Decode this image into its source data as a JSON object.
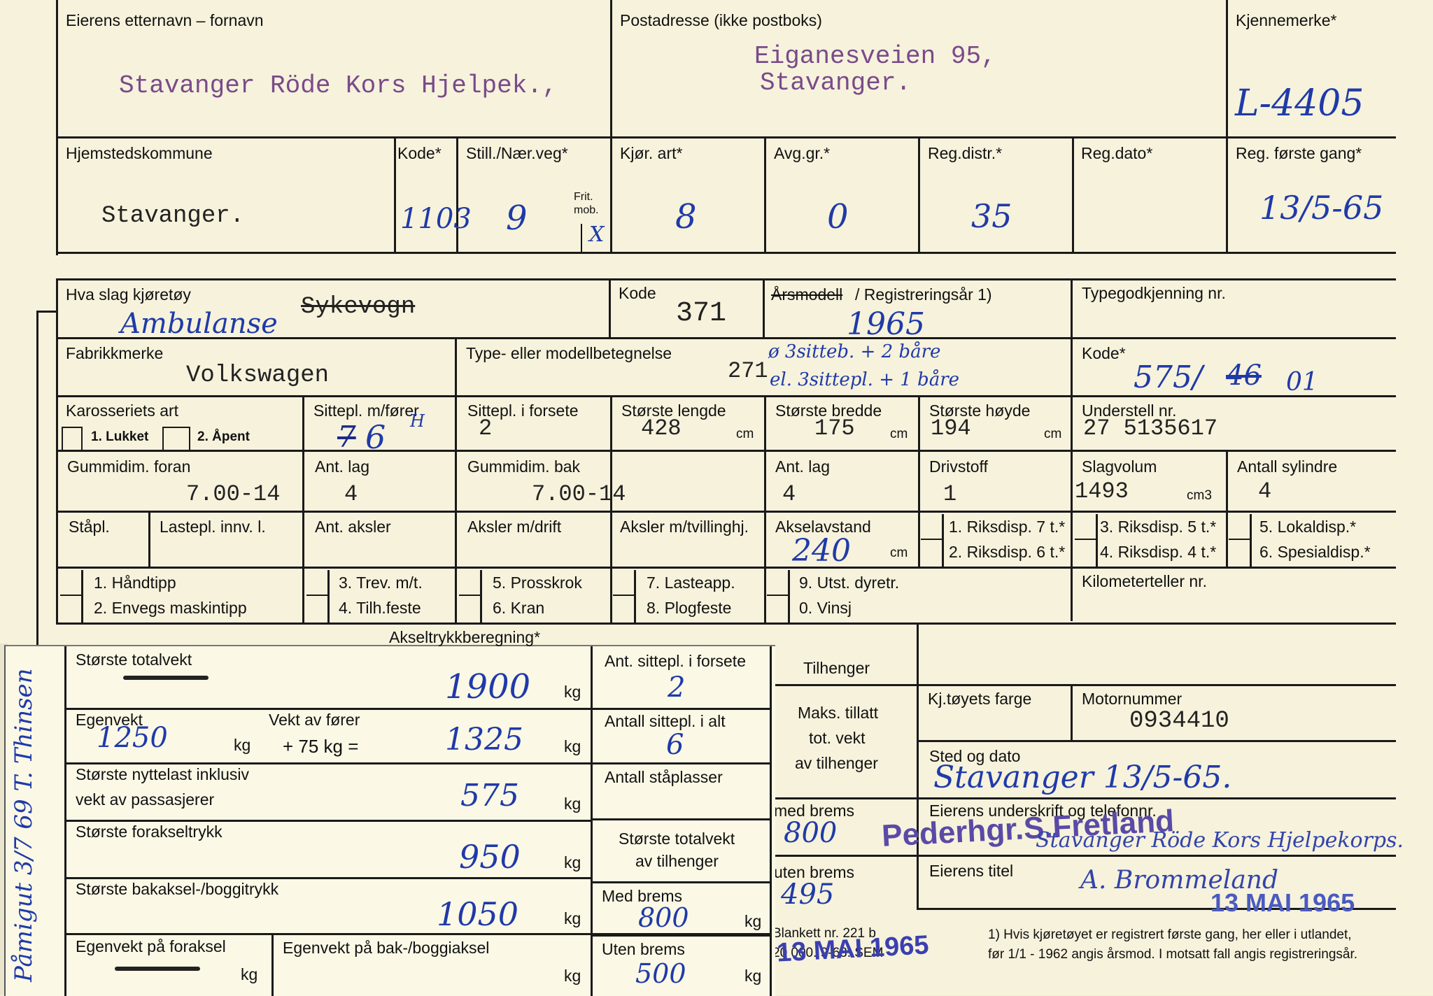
{
  "top": {
    "owner_label": "Eierens etternavn – fornavn",
    "owner_value": "Stavanger Röde Kors Hjelpek.,",
    "address_label": "Postadresse (ikke postboks)",
    "address_line1": "Eiganesveien 95,",
    "address_line2": "Stavanger.",
    "plate_label": "Kjennemerke*",
    "plate_value": "L-4405"
  },
  "row2": {
    "home_label": "Hjemstedskommune",
    "home_value": "Stavanger.",
    "kode_label": "Kode*",
    "kode_value": "1103",
    "still_label": "Still./Nær.veg*",
    "still_value": "9",
    "frit_label": "Frit. mob.",
    "frit_mark": "X",
    "kjor_label": "Kjør. art*",
    "kjor_value": "8",
    "avg_label": "Avg.gr.*",
    "avg_value": "0",
    "regdistr_label": "Reg.distr.*",
    "regdistr_value": "35",
    "regdato_label": "Reg.dato*",
    "regforste_label": "Reg. første gang*",
    "regforste_value": "13/5-65"
  },
  "vehicle": {
    "slag_label": "Hva slag kjøretøy",
    "slag_struck": "Sykevogn",
    "slag_hand": "Ambulanse",
    "kode_label": "Kode",
    "kode_value": "371",
    "aarsmodell_struck": "Årsmodell",
    "regaar_label": "/ Registreringsår 1)",
    "regaar_value": "1965",
    "typegodkj_label": "Typegodkjenning nr.",
    "fabrikk_label": "Fabrikkmerke",
    "fabrikk_value": "Volkswagen",
    "type_label": "Type- eller modellbetegnelse",
    "type_value": "271",
    "type_hand1": "ø 3sitteb. + 2 båre",
    "type_hand2": "el. 3sittepl. + 1 båre",
    "kode2_label": "Kode*",
    "kode2_hand": "575/",
    "kode2_struck": "46",
    "kode2_suffix": "01",
    "karosseri_label": "Karosseriets art",
    "lukket_label": "1. Lukket",
    "apent_label": "2. Åpent",
    "sittepl_label": "Sittepl. m/fører",
    "sittepl_hand": "6",
    "sittepl_struck": "7",
    "sittepl_sup": "H",
    "sitteforsete_label": "Sittepl. i forsete",
    "sitteforsete_value": "2",
    "lengde_label": "Største lengde",
    "lengde_value": "428",
    "bredde_label": "Største bredde",
    "bredde_value": "175",
    "hoyde_label": "Største høyde",
    "hoyde_value": "194",
    "cm": "cm",
    "understell_label": "Understell nr.",
    "understell_value": "27 5135617",
    "gummi_foran_label": "Gummidim. foran",
    "gummi_foran_value": "7.00-14",
    "antlag_label": "Ant. lag",
    "antlag1_value": "4",
    "gummi_bak_label": "Gummidim. bak",
    "gummi_bak_value": "7.00-14",
    "antlag2_value": "4",
    "drivstoff_label": "Drivstoff",
    "drivstoff_value": "1",
    "slagvolum_label": "Slagvolum",
    "slagvolum_value": "1493",
    "cm3": "cm3",
    "sylindre_label": "Antall sylindre",
    "sylindre_value": "4",
    "stapl_label": "Ståpl.",
    "lastepl_label": "Lastepl. innv. l.",
    "antaksler_label": "Ant. aksler",
    "aksler_drift_label": "Aksler m/drift",
    "aksler_tvill_label": "Aksler m/tvillinghj.",
    "akselavstand_label": "Akselavstand",
    "akselavstand_value": "240",
    "riks1": "1. Riksdisp. 7 t.*",
    "riks2": "2. Riksdisp. 6 t.*",
    "riks3": "3. Riksdisp. 5 t.*",
    "riks4": "4. Riksdisp. 4 t.*",
    "lokal5": "5. Lokaldisp.*",
    "spes6": "6. Spesialdisp.*",
    "o1": "1. Håndtipp",
    "o2": "2. Envegs maskintipp",
    "o3": "3. Trev. m/t.",
    "o4": "4. Tilh.feste",
    "o5": "5. Prosskrok",
    "o6": "6. Kran",
    "o7": "7. Lasteapp.",
    "o8": "8. Plogfeste",
    "o9": "9. Utst. dyretr.",
    "o0": "0. Vinsj",
    "km_label": "Kilometerteller nr."
  },
  "lower": {
    "akseltrykk_label": "Akseltrykkberegning*",
    "totalvekt_label": "Største totalvekt",
    "totalvekt_value": "1900",
    "kg": "kg",
    "egenvekt_label": "Egenvekt",
    "egenvekt_value": "1250",
    "forer_label": "Vekt av fører",
    "forer_expr": "+ 75 kg =",
    "sum_value": "1325",
    "nyttelast_label1": "Største nyttelast inklusiv",
    "nyttelast_label2": "vekt av passasjerer",
    "nyttelast_value": "575",
    "foraksel_label": "Største forakseltrykk",
    "foraksel_value": "950",
    "bakaksel_label": "Største bakaksel-/boggitrykk",
    "bakaksel_value": "1050",
    "egen_foraksel_label": "Egenvekt på foraksel",
    "egen_bakaksel_label": "Egenvekt på bak-/boggiaksel",
    "sitteforsete_label": "Ant. sittepl. i forsete",
    "sitteforsete_value": "2",
    "sittealt_label": "Antall sittepl. i alt",
    "sittealt_value": "6",
    "staplasser_label": "Antall ståplasser",
    "tilh_total_label1": "Største totalvekt",
    "tilh_total_label2": "av tilhenger",
    "medbrems_label": "Med brems",
    "medbrems_value": "800",
    "utenbrems_label": "Uten brems",
    "utenbrems_value": "500",
    "tilhenger_label": "Tilhenger",
    "maks1": "Maks. tillatt",
    "maks2": "tot. vekt",
    "maks3": "av tilhenger",
    "med_brems_right": "med brems",
    "med_brems_right_value": "800",
    "uten_brems_right": "uten brems",
    "uten_brems_right_value": "495",
    "farge_label": "Kj.tøyets farge",
    "motor_label": "Motornummer",
    "motor_value": "0934410",
    "sted_label": "Sted og dato",
    "sted_value": "Stavanger 13/5-65.",
    "underskrift_label": "Eierens underskrift og telefonnr.",
    "stamp_name": "Pederhgr.S.Fretland",
    "sig_line": "Stavanger Röde Kors Hjelpekorps.",
    "tittel_label": "Eierens titel",
    "tittel_sig": "A. Brommeland",
    "stamp_date": "13 MAI 1965",
    "blankett1": "Blankett nr. 221 b",
    "blankett2": "20 000. 9-63. SEM",
    "stamp_date2": "13 MAI 1965",
    "footnote1": "1) Hvis kjøretøyet er registrert første gang, her eller i utlandet,",
    "footnote2": "før 1/1 - 1962 angis årsmod.  I motsatt fall angis registreringsår.",
    "side_note": "Påmigut 3/7 69  T. Thinsen"
  }
}
